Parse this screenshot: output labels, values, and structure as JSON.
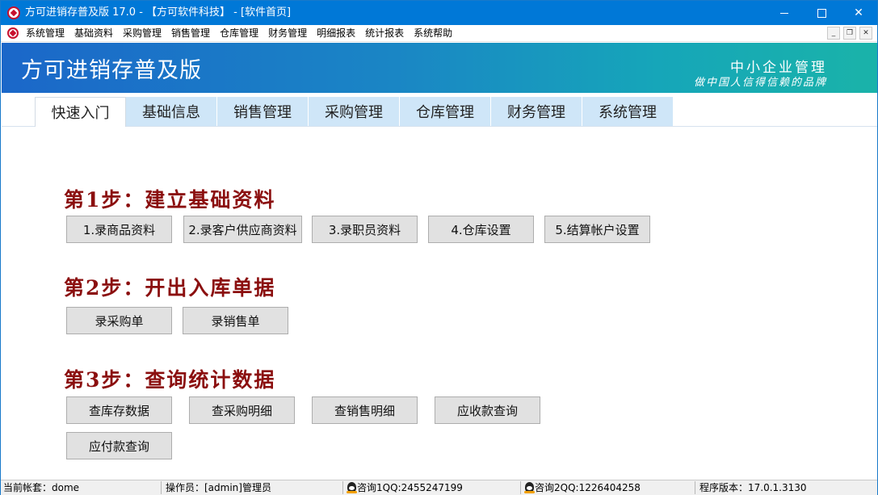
{
  "window": {
    "title": "方可进销存普及版 17.0 - 【方可软件科技】 - [软件首页]",
    "controls": {
      "minimize": "—",
      "maximize": "☐",
      "close": "✕"
    }
  },
  "menubar": {
    "items": [
      "系统管理",
      "基础资料",
      "采购管理",
      "销售管理",
      "仓库管理",
      "财务管理",
      "明细报表",
      "统计报表",
      "系统帮助"
    ],
    "mdi": {
      "minimize": "_",
      "restore": "❐",
      "close": "✕"
    }
  },
  "banner": {
    "title": "方可进销存普及版",
    "slogan_main": "中小企业管理",
    "slogan_sub": "做中国人信得信赖的品牌"
  },
  "tabs": [
    {
      "label": "快速入门",
      "active": true
    },
    {
      "label": "基础信息",
      "active": false
    },
    {
      "label": "销售管理",
      "active": false
    },
    {
      "label": "采购管理",
      "active": false
    },
    {
      "label": "仓库管理",
      "active": false
    },
    {
      "label": "财务管理",
      "active": false
    },
    {
      "label": "系统管理",
      "active": false
    }
  ],
  "steps": [
    {
      "title": "第1步：建立基础资料",
      "buttons": [
        "1.录商品资料",
        "2.录客户供应商资料",
        "3.录职员资料",
        "4.仓库设置",
        "5.结算帐户设置"
      ]
    },
    {
      "title": "第2步：开出入库单据",
      "buttons": [
        "录采购单",
        "录销售单"
      ]
    },
    {
      "title": "第3步：查询统计数据",
      "buttons": [
        "查库存数据",
        "查采购明细",
        "查销售明细",
        "应收款查询",
        "应付款查询"
      ]
    }
  ],
  "statusbar": {
    "account": "当前帐套：dome",
    "operator": "操作员：[admin]管理员",
    "qq1": "咨询1QQ:2455247199",
    "qq2": "咨询2QQ:1226404258",
    "version": "程序版本：17.0.1.3130"
  },
  "colors": {
    "titlebar": "#0078d7",
    "step_title": "#8b0f0f",
    "tab_bg": "#cfe6f8",
    "button_bg": "#e1e1e1"
  }
}
